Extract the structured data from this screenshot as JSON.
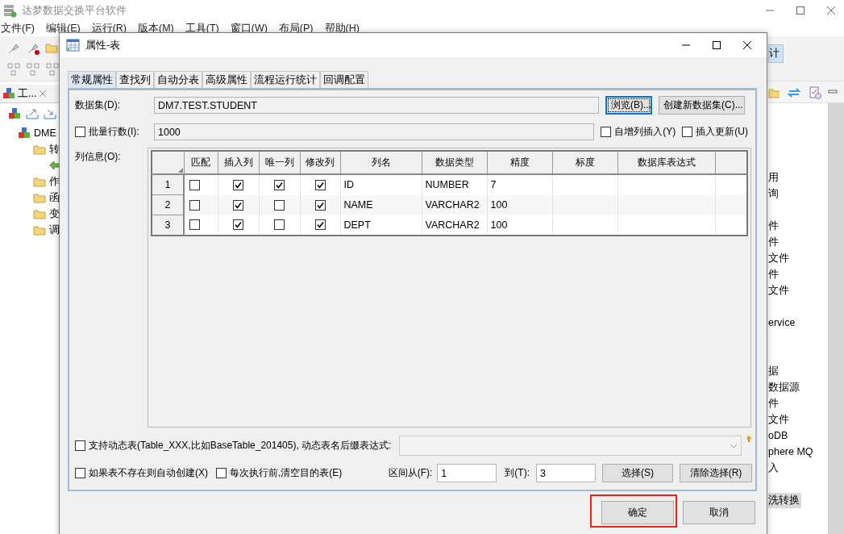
{
  "app": {
    "title": "达梦数据交换平台软件",
    "menu": [
      "文件(F)",
      "编辑(E)",
      "运行(R)",
      "版本(M)",
      "工具(T)",
      "窗口(W)",
      "布局(P)",
      "帮助(H)"
    ],
    "left_panel": {
      "tab": "工...",
      "tree": [
        {
          "kind": "database",
          "label": "DME",
          "children": [
            {
              "kind": "folder",
              "label": "转",
              "children": [
                {
                  "kind": "transform"
                }
              ]
            },
            {
              "kind": "folder",
              "label": "作"
            },
            {
              "kind": "folder",
              "label": "函"
            },
            {
              "kind": "folder",
              "label": "变"
            },
            {
              "kind": "folder",
              "label": "调"
            }
          ]
        }
      ]
    },
    "right_panel": {
      "toolbar_button": "计",
      "items": [
        {
          "label": "用",
          "selected": false
        },
        {
          "label": "询",
          "selected": false
        },
        {
          "label": "件",
          "selected": false
        },
        {
          "label": "件",
          "selected": false
        },
        {
          "label": "文件",
          "selected": false
        },
        {
          "label": "件",
          "selected": false
        },
        {
          "label": "文件",
          "selected": false
        },
        {
          "label": "ervice",
          "selected": false
        },
        {
          "label": "据",
          "selected": false
        },
        {
          "label": "数据源",
          "selected": false
        },
        {
          "label": "件",
          "selected": false
        },
        {
          "label": "文件",
          "selected": false
        },
        {
          "label": "oDB",
          "selected": false
        },
        {
          "label": "phere MQ",
          "selected": false
        },
        {
          "label": "入",
          "selected": false
        },
        {
          "label": "洗转换",
          "selected": true
        }
      ]
    }
  },
  "dialog": {
    "title": "属性-表",
    "tabs": [
      {
        "label": "常规属性",
        "selected": true
      },
      {
        "label": "查找列",
        "selected": false
      },
      {
        "label": "自动分表",
        "selected": false
      },
      {
        "label": "高级属性",
        "selected": false
      },
      {
        "label": "流程运行统计",
        "selected": false
      },
      {
        "label": "回调配置",
        "selected": false
      }
    ],
    "dataset": {
      "label": "数据集(D):",
      "value": "DM7.TEST.STUDENT"
    },
    "browse_button": "浏览(B)...",
    "create_button": "创建新数据集(C)...",
    "batch": {
      "label": "批量行数(I):",
      "checked": false,
      "value": "1000"
    },
    "options": [
      {
        "label": "自增列插入(Y)",
        "checked": false
      },
      {
        "label": "插入更新(U)",
        "checked": false
      }
    ],
    "columns_label": "列信息(O):",
    "table": {
      "columns": [
        "匹配",
        "插入列",
        "唯一列",
        "修改列",
        "列名",
        "数据类型",
        "精度",
        "标度",
        "数据库表达式"
      ],
      "rows": [
        {
          "number": "1",
          "match": false,
          "insert": true,
          "unique": true,
          "modify": true,
          "name": "ID",
          "type": "NUMBER",
          "precision": "7"
        },
        {
          "number": "2",
          "match": false,
          "insert": true,
          "unique": false,
          "modify": true,
          "name": "NAME",
          "type": "VARCHAR2",
          "precision": "100"
        },
        {
          "number": "3",
          "match": false,
          "insert": true,
          "unique": false,
          "modify": true,
          "name": "DEPT",
          "type": "VARCHAR2",
          "precision": "100"
        }
      ]
    },
    "dynamic": {
      "label": "支持动态表(Table_XXX,比如BaseTable_201405), 动态表名后缀表达式:",
      "checked": false
    },
    "auto_create": {
      "label": "如果表不存在则自动创建(X)",
      "checked": false
    },
    "truncate": {
      "label": "每次执行前,清空目的表(E)",
      "checked": false
    },
    "range": {
      "from_label": "区间从(F):",
      "from": "1",
      "to_label": "到(T):",
      "to": "3"
    },
    "select_button": "选择(S)",
    "clear_button": "清除选择(R)",
    "ok_button": {
      "label": "确定",
      "highlighted": true
    },
    "cancel_button": "取消"
  }
}
